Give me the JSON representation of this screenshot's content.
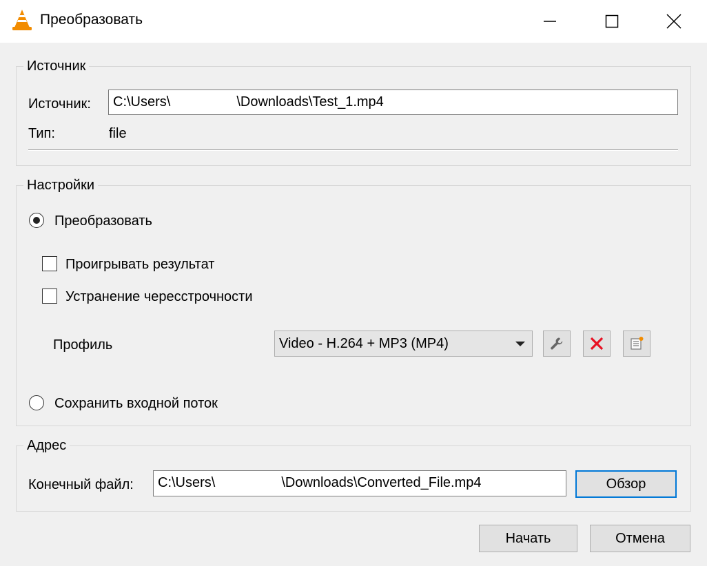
{
  "window": {
    "title": "Преобразовать",
    "app_icon": "vlc-cone-icon",
    "controls": [
      "minimize-icon",
      "maximize-icon",
      "close-icon"
    ]
  },
  "source_group": {
    "legend": "Источник",
    "source_label": "Источник:",
    "source_value_start": "C:\\Users\\",
    "source_value_end": "\\Downloads\\Test_1.mp4",
    "type_label": "Тип:",
    "type_value": "file"
  },
  "settings_group": {
    "legend": "Настройки",
    "convert_radio": {
      "label": "Преобразовать",
      "selected": true
    },
    "play_result_checkbox": {
      "label": "Проигрывать результат",
      "checked": false
    },
    "deinterlace_checkbox": {
      "label": "Устранение чересстрочности",
      "checked": false
    },
    "profile_label": "Профиль",
    "profile_selected": "Video - H.264 + MP3 (MP4)",
    "profile_tools": [
      "wrench-icon",
      "delete-x-icon",
      "new-profile-icon"
    ],
    "dump_radio": {
      "label": "Сохранить входной поток",
      "selected": false
    }
  },
  "destination_group": {
    "legend": "Адрес",
    "dest_label": "Конечный файл:",
    "dest_value_start": "C:\\Users\\",
    "dest_value_end": "\\Downloads\\Converted_File.mp4",
    "browse_label": "Обзор"
  },
  "footer": {
    "start_label": "Начать",
    "cancel_label": "Отмена"
  },
  "colors": {
    "accent": "#0078d7",
    "delete_red": "#e81123",
    "vlc_orange": "#f28c00"
  }
}
